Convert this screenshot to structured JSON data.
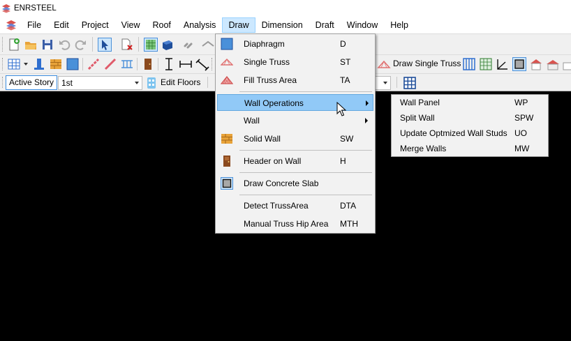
{
  "window": {
    "title": "ENRSTEEL"
  },
  "menubar": {
    "items": [
      "File",
      "Edit",
      "Project",
      "View",
      "Roof",
      "Analysis",
      "Draw",
      "Dimension",
      "Draft",
      "Window",
      "Help"
    ],
    "active": "Draw"
  },
  "toolbar": {
    "draw_single_truss_label": "Draw Single Truss",
    "active_story_label": "Active Story",
    "story_value": "1st",
    "edit_floors_label": "Edit Floors"
  },
  "draw_menu": {
    "items": [
      {
        "label": "Diaphragm",
        "shortcut": "D",
        "icon": "diaphragm-icon"
      },
      {
        "label": "Single Truss",
        "shortcut": "ST",
        "icon": "single-truss-icon"
      },
      {
        "label": "Fill Truss Area",
        "shortcut": "TA",
        "icon": "fill-truss-icon"
      },
      {
        "label": "Wall Operations",
        "shortcut": "",
        "submenu": true
      },
      {
        "label": "Wall",
        "shortcut": "",
        "submenu": true
      },
      {
        "label": "Solid Wall",
        "shortcut": "SW",
        "icon": "brick-wall-icon"
      },
      {
        "label": "Header on Wall",
        "shortcut": "H",
        "icon": "door-icon"
      },
      {
        "label": "Draw Concrete Slab",
        "shortcut": "",
        "icon": "slab-icon"
      },
      {
        "label": "Detect TrussArea",
        "shortcut": "DTA"
      },
      {
        "label": "Manual Truss Hip Area",
        "shortcut": "MTH"
      }
    ],
    "highlighted": "Wall Operations"
  },
  "wall_operations_submenu": {
    "items": [
      {
        "label": "Wall Panel",
        "shortcut": "WP"
      },
      {
        "label": "Split Wall",
        "shortcut": "SPW"
      },
      {
        "label": "Update Optmized Wall Studs",
        "shortcut": "UO"
      },
      {
        "label": "Merge Walls",
        "shortcut": "MW"
      }
    ]
  },
  "colors": {
    "highlight": "#91c9f7",
    "menu_bg": "#f2f2f2",
    "canvas": "#000000",
    "accent_blue": "#2f6fcf"
  }
}
